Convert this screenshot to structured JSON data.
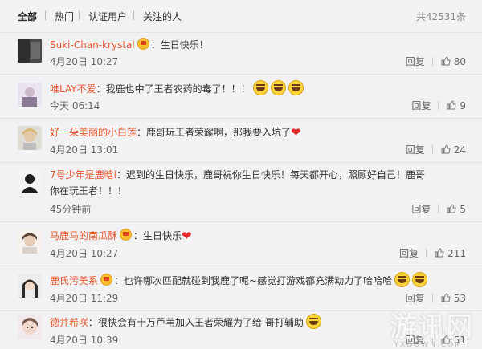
{
  "tabs": [
    "全部",
    "热门",
    "认证用户",
    "关注的人"
  ],
  "total": "共42531条",
  "comments": [
    {
      "user": "Suki-Chan-krystal",
      "badge": true,
      "text": "：生日快乐！",
      "emoji": [],
      "time": "4月20日 10:27",
      "reply": "回复",
      "likes": "80"
    },
    {
      "user": "唯LAY不爱",
      "badge": false,
      "text": "：我鹿也中了王者农药的毒了！！！",
      "emoji": [
        "laugh",
        "laugh",
        "laugh"
      ],
      "time": "今天 06:14",
      "reply": "回复",
      "likes": "9"
    },
    {
      "user": "好一朵美丽的小白莲",
      "badge": false,
      "text": "：鹿哥玩王者荣耀啊，那我要入坑了",
      "emoji": [
        "heart"
      ],
      "time": "4月20日 13:01",
      "reply": "回复",
      "likes": "24"
    },
    {
      "user": "7号少年是鹿晗i",
      "badge": false,
      "text": "：迟到的生日快乐，鹿哥祝你生日快乐！每天都开心，照顾好自己！鹿哥你在玩王者！！！",
      "emoji": [],
      "time": "45分钟前",
      "reply": "回复",
      "likes": "5"
    },
    {
      "user": "马鹿马的南瓜酥",
      "badge": true,
      "text": "：生日快乐",
      "emoji": [
        "heart"
      ],
      "time": "4月20日 10:27",
      "reply": "回复",
      "likes": "211"
    },
    {
      "user": "鹿氏污美系",
      "badge": true,
      "text": "：也许哪次匹配就碰到我鹿了呢~感觉打游戏都充满动力了哈哈哈",
      "emoji": [
        "laugh",
        "laugh"
      ],
      "time": "4月20日 11:29",
      "reply": "回复",
      "likes": "53"
    },
    {
      "user": "德井希咲",
      "badge": false,
      "text": "：很快会有十万芦苇加入王者荣耀为了给 哥打辅助",
      "emoji": [
        "laugh"
      ],
      "time": "4月20日 10:39",
      "reply": "回复",
      "likes": "51"
    }
  ],
  "watermark": "游讯网",
  "watermark_sub": "YXDOWN.COM"
}
